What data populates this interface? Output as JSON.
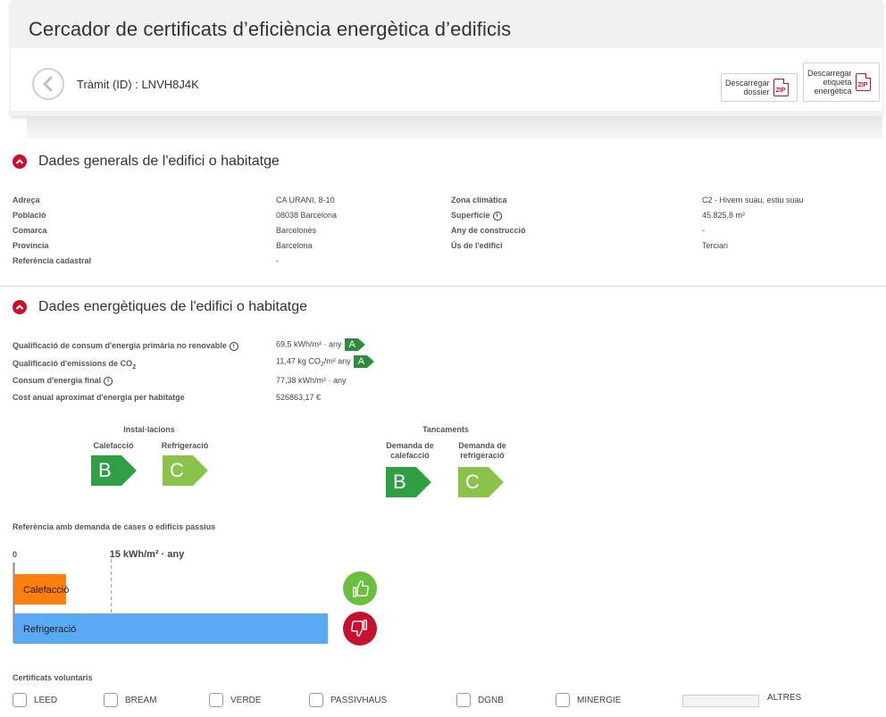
{
  "header": {
    "title": "Cercador de certificats d’eficiència energètica d’edificis",
    "tramit": "Tràmit (ID) : LNVH8J4K",
    "dl_dossier": [
      "Descarregar",
      "dossier"
    ],
    "dl_etiqueta": [
      "Descarregar",
      "etiqueta",
      "energètica"
    ],
    "zip": "ZIP"
  },
  "general": {
    "title": "Dades generals de l'edifici o habitatge",
    "adreca_label": "Adreça",
    "adreca_value": "CA URANI, 8-10",
    "poblacio_label": "Població",
    "poblacio_value": "08038 Barcelona",
    "comarca_label": "Comarca",
    "comarca_value": "Barcelonès",
    "provincia_label": "Província",
    "provincia_value": "Barcelona",
    "cadastral_label": "Referència cadastral",
    "cadastral_value": "-",
    "zona_label": "Zona climàtica",
    "zona_value": "C2 - Hivern suau, estiu suau",
    "superficie_label": "Superfície",
    "superficie_value": "45.825,8 m²",
    "any_label": "Any de construcció",
    "any_value": "-",
    "us_label": "Ús de l'edifici",
    "us_value": "Terciari"
  },
  "energy": {
    "title": "Dades energètiques de l'edifici o habitatge",
    "primaria_label": "Qualificació de consum d'energia primària no renovable",
    "primaria_value": "69,5 kWh/m² · any",
    "primaria_grade": "A",
    "emissions_label_pre": "Qualificació d'emissions de CO",
    "emissions_label_sub": "2",
    "emissions_value_pre": "11,47 kg CO",
    "emissions_value_sub": "2",
    "emissions_value_post": "/m² any",
    "emissions_grade": "A",
    "final_label": "Consum d'energia final",
    "final_value": "77,38 kWh/m² · any",
    "cost_label": "Cost anual aproximat d'energia per habitatge",
    "cost_value": "526863,17 €",
    "installacions_title": "Instal·lacions",
    "calefaccio_label": "Calefacció",
    "calefaccio_grade": "B",
    "refrigeracio_label": "Refrigeració",
    "refrigeracio_grade": "C",
    "tancaments_title": "Tancaments",
    "dem_calef_label_1": "Demanda de",
    "dem_calef_label_2": "calefacció",
    "dem_calef_grade": "B",
    "dem_refrig_label_1": "Demanda de",
    "dem_refrig_label_2": "refrigeració",
    "dem_refrig_grade": "C",
    "info_icon": "i"
  },
  "reference": {
    "title": "Referència amb demanda de cases o edificis passius",
    "zero_label": "0",
    "threshold_label": "15 kWh/m² · any",
    "thumbs_up_icon": "thumbs-up-icon",
    "thumbs_down_icon": "thumbs-down-icon"
  },
  "chart_data": {
    "type": "bar",
    "orientation": "horizontal",
    "categories": [
      "Calefacció",
      "Refrigeració"
    ],
    "values": [
      8,
      48.5
    ],
    "threshold": 15,
    "xlim": [
      0,
      50
    ],
    "colors": {
      "Calefacció": "#ff7f0e",
      "Refrigeració": "#5aa9f5"
    }
  },
  "voluntary": {
    "title": "Certificats voluntaris",
    "options": [
      "LEED",
      "BREAM",
      "VERDE",
      "PASSIVHAUS",
      "DGNB",
      "MINERGIE"
    ],
    "altres_label": "ALTRES"
  },
  "colors": {
    "accent_red": "#c8102e",
    "grade_a": "#2e8b3a",
    "grade_b": "#2ea043",
    "grade_c": "#8bc34a",
    "thumb_up": "#6abf3f",
    "thumb_down": "#c8102e"
  }
}
